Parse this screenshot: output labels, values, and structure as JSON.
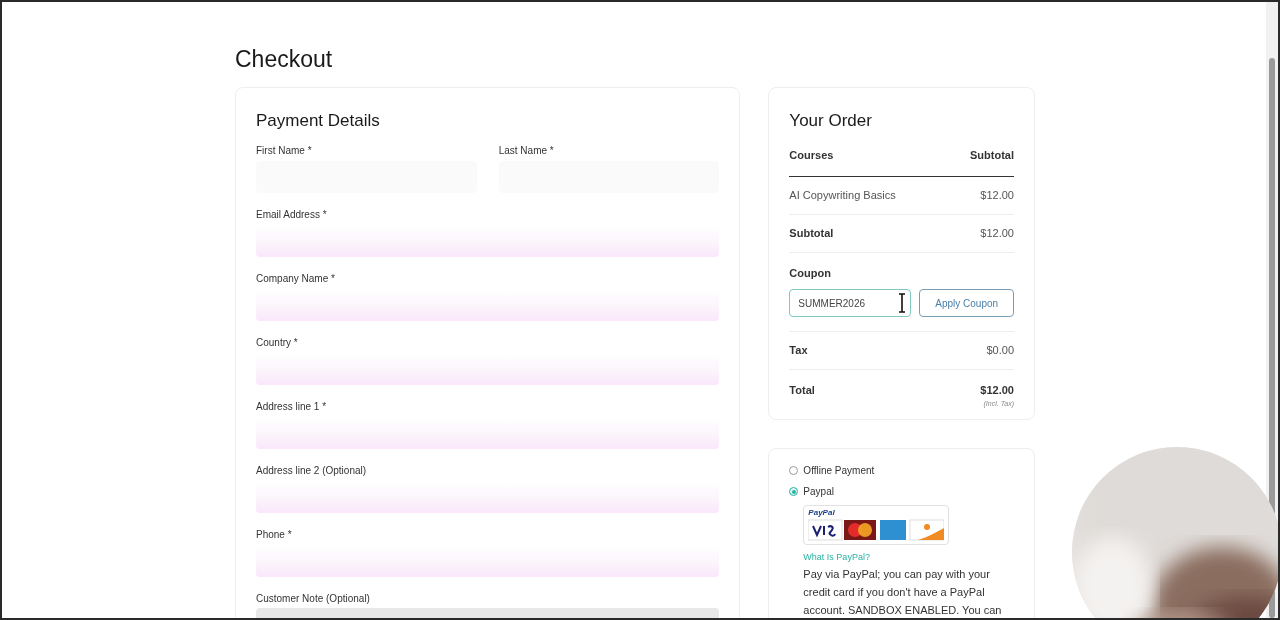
{
  "title": "Checkout",
  "payment_details": {
    "heading": "Payment Details",
    "name_row": [
      {
        "label": "First Name *"
      },
      {
        "label": "Last Name *"
      }
    ],
    "fields": [
      {
        "label": "Email Address *"
      },
      {
        "label": "Company Name *"
      },
      {
        "label": "Country *"
      },
      {
        "label": "Address line 1 *"
      },
      {
        "label": "Address line 2 (Optional)"
      },
      {
        "label": "Phone *"
      }
    ],
    "note": {
      "label": "Customer Note (Optional)"
    }
  },
  "order": {
    "heading": "Your Order",
    "columns": [
      "Courses",
      "Subtotal"
    ],
    "items": [
      {
        "name": "AI Copywriting Basics",
        "price": "$12.00"
      }
    ],
    "subtotal": {
      "label": "Subtotal",
      "value": "$12.00"
    },
    "coupon": {
      "label": "Coupon",
      "value": "SUMMER2026",
      "button": "Apply Coupon"
    },
    "tax": {
      "label": "Tax",
      "value": "$0.00"
    },
    "total": {
      "label": "Total",
      "value": "$12.00",
      "note": "(Incl. Tax)"
    }
  },
  "payment_methods": [
    {
      "label": "Offline Payment",
      "selected": false
    },
    {
      "label": "Paypal",
      "selected": true,
      "logo_caption": "PayPal",
      "link": "What Is PayPal?",
      "description": "Pay via PayPal; you can pay with your credit card if you don't have a PayPal account. SANDBOX ENABLED. You can"
    }
  ]
}
